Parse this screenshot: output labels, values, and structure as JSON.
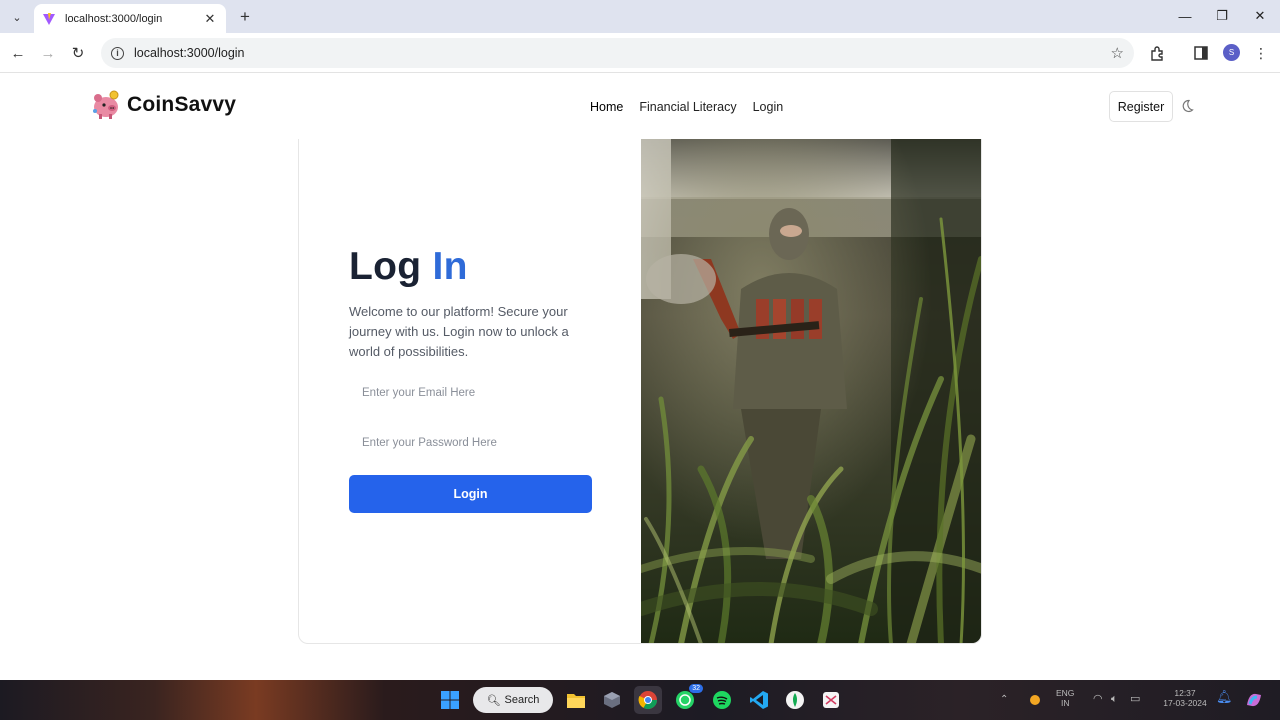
{
  "browser": {
    "tab_title": "localhost:3000/login",
    "tab_close": "✕",
    "new_tab": "+",
    "url": "localhost:3000/login",
    "profile_initial": "S"
  },
  "navbar": {
    "brand": "CoinSavvy",
    "links": [
      {
        "label": "Home"
      },
      {
        "label": "Financial Literacy"
      },
      {
        "label": "Login"
      }
    ],
    "register_label": "Register"
  },
  "login": {
    "heading_main": "Log",
    "heading_accent": "In",
    "subtitle": "Welcome to our platform! Secure your journey with us. Login now to unlock a world of possibilities.",
    "email_placeholder": "Enter your Email Here",
    "password_placeholder": "Enter your Password Here",
    "submit_label": "Login"
  },
  "taskbar": {
    "search_label": "Search",
    "whatsapp_badge": "32",
    "lang": "ENG",
    "region": "IN",
    "time": "12:37",
    "date": "17-03-2024"
  },
  "colors": {
    "accent": "#2f6bd8",
    "button": "#2563eb",
    "heading": "#1a2233"
  }
}
